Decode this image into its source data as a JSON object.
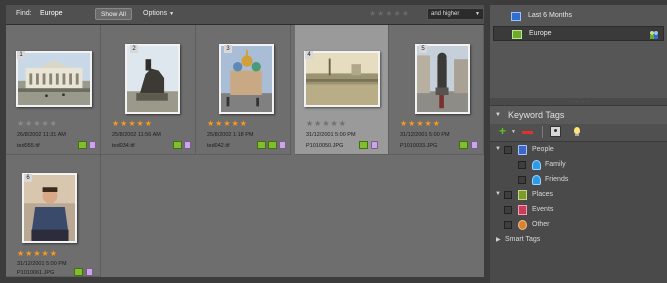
{
  "find_bar": {
    "label": "Find:",
    "value": "Europe",
    "show_all": "Show All",
    "options": "Options",
    "rating_filter": "and higher"
  },
  "photos": [
    {
      "num": "1",
      "stars": 0,
      "date": "26/8/2002 11:31 AM",
      "file": "ted055.tif",
      "selected": false
    },
    {
      "num": "2",
      "stars": 5,
      "date": "25/8/2002 11:56 AM",
      "file": "ted034.tif",
      "selected": false
    },
    {
      "num": "3",
      "stars": 5,
      "date": "25/8/2002 1:18 PM",
      "file": "ted042.tif",
      "selected": false
    },
    {
      "num": "4",
      "stars": 0,
      "date": "31/12/2001 5:00 PM",
      "file": "P1010050.JPG",
      "selected": true
    },
    {
      "num": "5",
      "stars": 5,
      "date": "31/12/2001 5:00 PM",
      "file": "P1010033.JPG",
      "selected": false
    },
    {
      "num": "6",
      "stars": 5,
      "date": "31/12/2001 5:00 PM",
      "file": "P1010061.JPG",
      "selected": false
    }
  ],
  "albums": [
    {
      "label": "Last 6 Months",
      "icon": "smart-album-icon"
    },
    {
      "label": "Europe",
      "icon": "album-icon"
    }
  ],
  "keyword_panel": {
    "title": "Keyword Tags",
    "tree": [
      {
        "label": "People",
        "icon": "people-category-icon"
      },
      {
        "label": "Family",
        "icon": "person-tag-icon"
      },
      {
        "label": "Friends",
        "icon": "person-tag-icon"
      },
      {
        "label": "Places",
        "icon": "places-category-icon"
      },
      {
        "label": "Events",
        "icon": "events-category-icon"
      },
      {
        "label": "Other",
        "icon": "other-category-icon"
      },
      {
        "label": "Smart Tags",
        "icon": "expand-arrow-icon"
      }
    ]
  },
  "colors": {
    "star_on": "#ff9a1a",
    "star_off": "#8a8a8a",
    "tile_bg": "#6e6e6e",
    "tile_selected": "#9a9a9a",
    "panel_bg": "#4a4a4a"
  }
}
